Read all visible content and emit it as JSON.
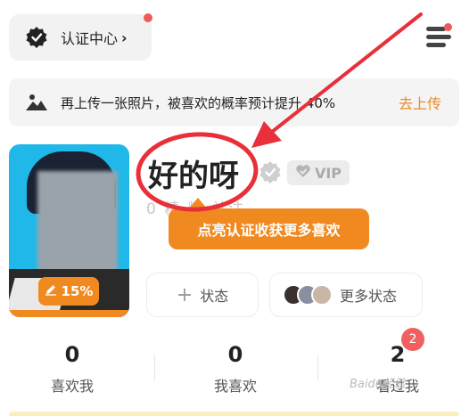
{
  "header": {
    "cert_label": "认证中心",
    "cert_chevron": "›"
  },
  "banner": {
    "text": "再上传一张照片，被喜欢的概率预计提升 40%",
    "link": "去上传"
  },
  "profile": {
    "photo_progress_label": "15%",
    "photo_progress_value": 0.15,
    "username": "好的呀",
    "vip_label": "VIP",
    "sub_stats": "0 精 粉 关注"
  },
  "tooltip": {
    "text": "点亮认证收获更多喜欢"
  },
  "actions": {
    "status_label": "状态",
    "more_status_label": "更多状态"
  },
  "stats": [
    {
      "value": "0",
      "label": "喜欢我"
    },
    {
      "value": "0",
      "label": "我喜欢"
    },
    {
      "value": "2",
      "label": "看过我"
    }
  ],
  "badges": {
    "views_count": "2"
  },
  "watermark": "Baidu经验",
  "colors": {
    "accent": "#f08a20",
    "annotation_red": "#e8303a",
    "badge_red": "#f06060"
  },
  "icons": {
    "cert": "verified-badge-icon",
    "menu": "menu-lines-icon",
    "banner": "image-mountain-icon",
    "shield": "shield-check-icon",
    "vip": "heart-vip-icon",
    "plus": "plus-icon",
    "pencil": "pencil-icon"
  }
}
